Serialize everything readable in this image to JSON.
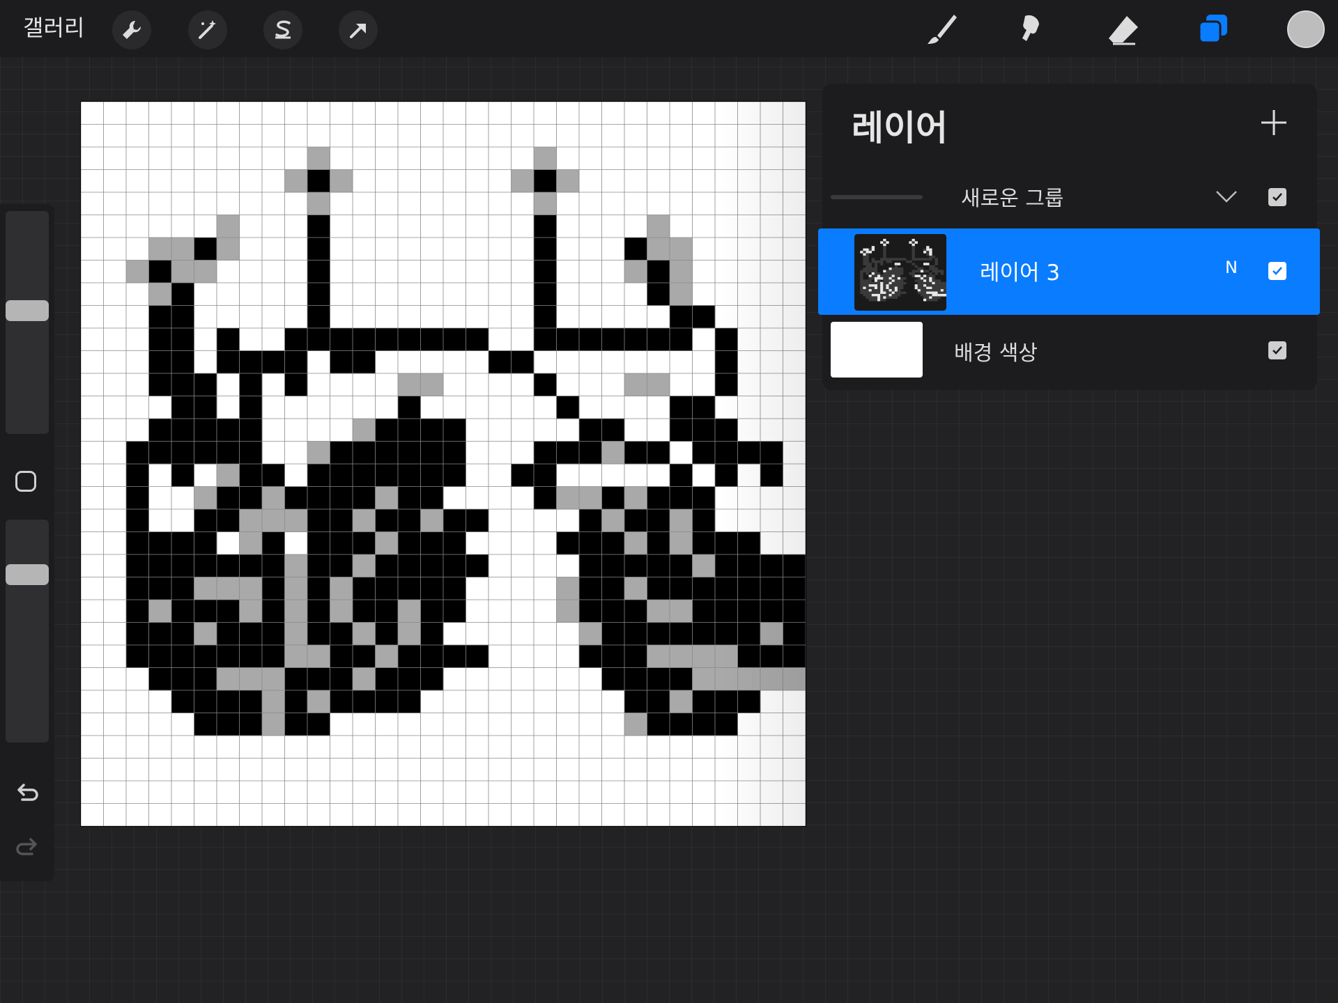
{
  "toolbar": {
    "gallery_label": "갤러리",
    "left_tools": [
      "wrench-icon",
      "magic-wand-icon",
      "selection-icon",
      "transform-arrow-icon"
    ],
    "right_tools": [
      "brush-icon",
      "smudge-icon",
      "eraser-icon",
      "layers-icon"
    ],
    "active_tool": "layers-icon",
    "current_color": "#bdbdbd",
    "accent_color": "#0a7cff"
  },
  "sidebar": {
    "brush_size_level": 0.44,
    "opacity_level": 0.22,
    "icons": [
      "modify-square-icon",
      "undo-icon",
      "redo-icon"
    ]
  },
  "layers_panel": {
    "title": "레이어",
    "add_icon": "plus-icon",
    "group": {
      "name": "새로운 그룹",
      "expanded": true,
      "visible": true
    },
    "layers": [
      {
        "name": "레이어 3",
        "blend_mode": "N",
        "visible": true,
        "selected": true
      }
    ],
    "background": {
      "name": "배경 색상",
      "color": "#ffffff",
      "visible": true
    }
  },
  "canvas": {
    "grid_columns": 32,
    "grid_rows": 32,
    "pixel_rows": [
      "................................",
      "................................",
      "..........-.........-...........",
      ".........-#-.......-#-..........",
      "..........-.........-...........",
      "......-...#.........#....-......",
      "...--#-...#.........#...#--.....",
      "..-#--....#.........#...-#-.....",
      "...-#.....#.........#....#-.....",
      "...##.....#.........#.....##....",
      "...##.#..#########..#######.#...",
      "...##.####.##.....##........#...",
      "...###.#.#....--....#...--..#...",
      "....##.#......#......#....##....",
      "...#####....-####.....##..###...",
      "..######..-######...###-##.####.",
      "..#.#.-##.#######..##.....#.#.#.",
      "..#..-##-####-##....#--#-###....",
      "..#..##---##-##-##....#-##-#....",
      "..####.-#.###-###....###-#-###..",
      "..#######-##-#####....#####-####",
      "..###---#-#-#####....-##-#######",
      "..#-###-#-#-##-##....-###--#####",
      "..###-###-##-#-#......-#######-#",
      "..#######--##-####....###----###",
      "...###---###-###.......####-----",
      "....####-#-####.........##-###..",
      ".....###-##.............-####...",
      "................................",
      "................................",
      "................................",
      "................................"
    ]
  }
}
